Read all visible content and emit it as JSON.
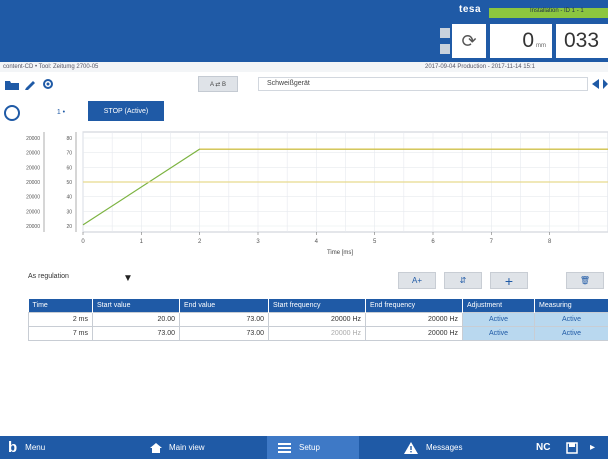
{
  "header": {
    "brand": "tesa",
    "status_text": "Installation - ID 1 - 1",
    "counter_value": "0",
    "counter_unit": "mm",
    "counter2_value": "033"
  },
  "infoline": {
    "left": "content-CD • Tool: Zeitumg 2700-05",
    "right": "2017-09-04 Production - 2017-11-14 15:1"
  },
  "toolbar": {
    "ab_label": "A  ⇄  B",
    "program_name": "Schweißgerät"
  },
  "tabs": {
    "small_label": "1 •",
    "active_label": "STOP (Active)"
  },
  "chart_data": {
    "type": "line",
    "title": "",
    "xlabel": "Time [ms]",
    "ylabel": "",
    "x_ticks": [
      "0",
      "1",
      "2",
      "3",
      "4",
      "5",
      "6",
      "7",
      "8"
    ],
    "y_ticks_outer": [
      "20000",
      "20000",
      "20000",
      "20000",
      "20000",
      "20000",
      "20000"
    ],
    "y_ticks_inner": [
      "80",
      "70",
      "60",
      "50",
      "40",
      "30",
      "20"
    ],
    "xlim": [
      0,
      9
    ],
    "ylim": [
      15,
      85
    ],
    "series": [
      {
        "name": "",
        "color": "#7cb341",
        "x": [
          0,
          2,
          9
        ],
        "y": [
          20,
          73,
          73
        ]
      },
      {
        "name": "",
        "color": "#d9c24a",
        "x": [
          2,
          9
        ],
        "y": [
          73,
          73
        ]
      },
      {
        "name": "",
        "color": "#e7d98e",
        "x": [
          0,
          9
        ],
        "y": [
          50,
          50
        ]
      }
    ],
    "grid": true
  },
  "segments": {
    "select_label": "As regulation",
    "buttons": [
      {
        "label": "A+",
        "icon": "add-text-icon"
      },
      {
        "label": "⇵",
        "icon": "reorder-icon"
      },
      {
        "label": "+",
        "icon": "plus-icon"
      },
      {
        "label": "🗑",
        "icon": "trash-icon"
      }
    ],
    "columns": [
      "Time",
      "Start value",
      "End value",
      "Start frequency",
      "End frequency",
      "Adjustment",
      "Measuring"
    ],
    "rows": [
      [
        "2 ms",
        "20.00",
        "73.00",
        "20000 Hz",
        "20000 Hz",
        "Active",
        "Active"
      ],
      [
        "7 ms",
        "73.00",
        "73.00",
        "20000 Hz",
        "20000 Hz",
        "Active",
        "Active"
      ]
    ]
  },
  "bottom_nav": {
    "menu": "Menu",
    "main_view": "Main view",
    "setup": "Setup",
    "messages": "Messages",
    "nc": "NC"
  },
  "colors": {
    "primary": "#1f5aa6",
    "status": "#8cc63f",
    "highlight": "#b9d8ef"
  }
}
